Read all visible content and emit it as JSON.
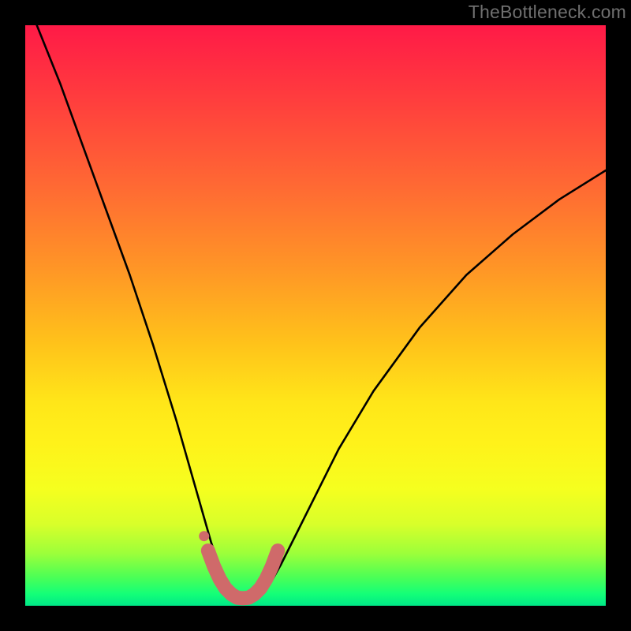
{
  "watermark": "TheBottleneck.com",
  "gradient_colors": {
    "top": "#ff1a47",
    "mid_upper": "#ff9626",
    "mid": "#ffe619",
    "mid_lower": "#d8ff2a",
    "bottom": "#00e887"
  },
  "chart_data": {
    "type": "line",
    "title": "",
    "xlabel": "",
    "ylabel": "",
    "xlim": [
      0,
      100
    ],
    "ylim": [
      0,
      100
    ],
    "grid": false,
    "series": [
      {
        "name": "main-curve",
        "color": "#000000",
        "x": [
          2,
          6,
          10,
          14,
          18,
          22,
          26,
          28,
          30,
          32,
          33,
          34,
          35,
          36,
          37,
          38,
          39,
          40,
          41,
          42,
          44,
          48,
          54,
          60,
          68,
          76,
          84,
          92,
          100
        ],
        "y": [
          100,
          90,
          79,
          68,
          57,
          45,
          32,
          25,
          18,
          11,
          8,
          5.5,
          3.5,
          2.2,
          1.4,
          1.1,
          1.1,
          1.4,
          2.2,
          3.5,
          7,
          15,
          27,
          37,
          48,
          57,
          64,
          70,
          75
        ]
      },
      {
        "name": "bottom-marker",
        "color": "#cf6a6a",
        "x": [
          31.5,
          32.5,
          33.5,
          34.5,
          35.5,
          36.5,
          37.5,
          38.5,
          39.5,
          40.5,
          41.5,
          42.5,
          43.5
        ],
        "y": [
          9.5,
          6.8,
          4.6,
          3.0,
          2.0,
          1.4,
          1.3,
          1.4,
          2.0,
          3.0,
          4.6,
          6.8,
          9.5
        ]
      },
      {
        "name": "marker-dot",
        "color": "#cf6a6a",
        "x": [
          30.8
        ],
        "y": [
          12
        ]
      }
    ]
  }
}
